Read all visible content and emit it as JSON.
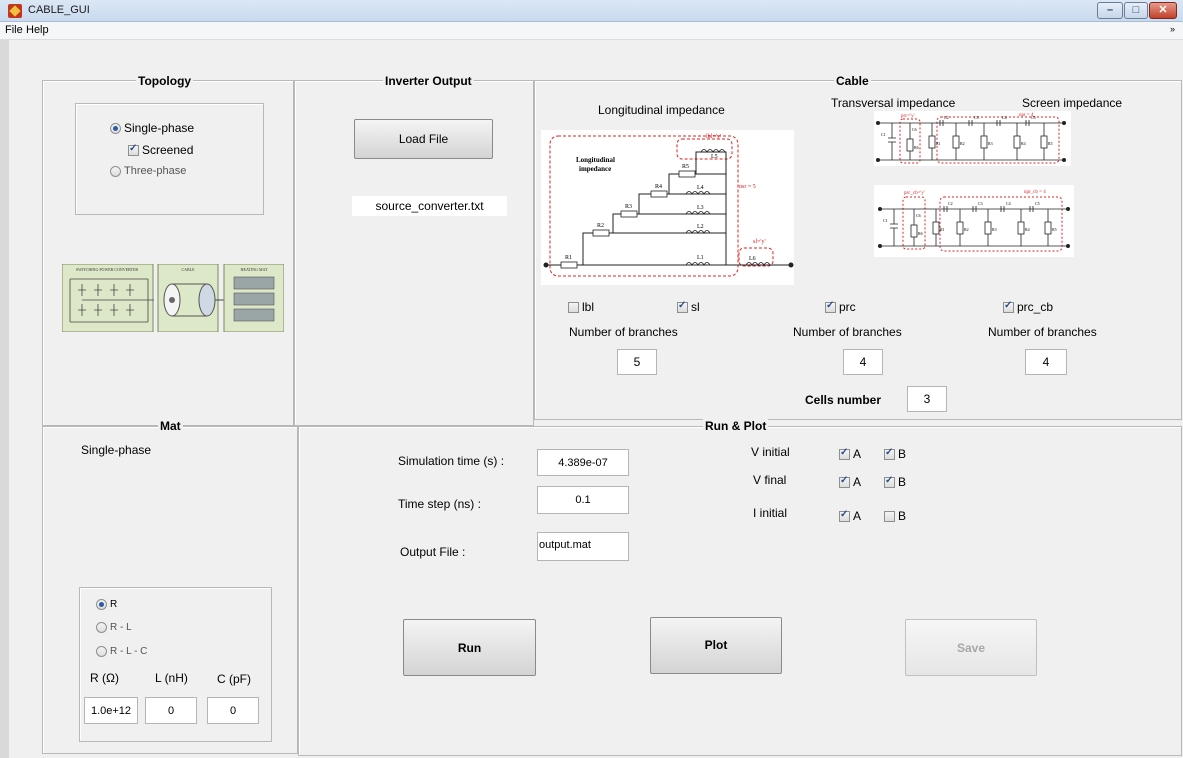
{
  "window": {
    "title": "CABLE_GUI",
    "controls": [
      "–",
      "□",
      "✕"
    ]
  },
  "menu": {
    "items": [
      "File",
      "Help"
    ],
    "arrow": "»"
  },
  "topology": {
    "title": "Topology",
    "options": {
      "single_phase": "Single-phase",
      "screened": "Screened",
      "three_phase": "Three-phase"
    },
    "image_labels": {
      "converter": "SWITCHING POWER CONVERTER",
      "cable": "CABLE",
      "mat": "HEATING MAT"
    }
  },
  "inverter": {
    "title": "Inverter Output",
    "load_button": "Load File",
    "file_name": "source_converter.txt"
  },
  "cable": {
    "title": "Cable",
    "longitudinal_title": "Longitudinal impedance",
    "transversal_title": "Transversal impedance",
    "screen_title": "Screen impedance",
    "diag_long": {
      "label1": "Longitudinal",
      "label2": "impedance",
      "lbl": "lbl='y'",
      "nsr": "nsr = 5",
      "sl": "sl='y'",
      "r": [
        "R1",
        "R2",
        "R3",
        "R4",
        "R5"
      ],
      "l": [
        "L1",
        "L2",
        "L3",
        "L4",
        "L5",
        "L6"
      ]
    },
    "diag_trans": {
      "prc": "prc='y'",
      "npr": "npr = 4",
      "labels": [
        "C1",
        "C6",
        "R6",
        "R1",
        "C2",
        "R2",
        "C3",
        "R3",
        "C4",
        "R4",
        "C5",
        "R5"
      ]
    },
    "diag_screen": {
      "prc": "prc_cb='y'",
      "npr": "npr_cb = 4",
      "labels": [
        "C1",
        "C6",
        "R6",
        "R1",
        "C2",
        "R2",
        "C3",
        "R3",
        "C4",
        "R4",
        "C5",
        "R5"
      ]
    },
    "checks": {
      "lbl": "lbl",
      "sl": "sl",
      "prc": "prc",
      "prc_cb": "prc_cb"
    },
    "branches_label": "Number of branches",
    "branches": [
      "5",
      "4",
      "4"
    ],
    "cells_label": "Cells number",
    "cells_value": "3"
  },
  "mat": {
    "title": "Mat",
    "phase_text": "Single-phase",
    "options": {
      "r": "R",
      "rl": "R - L",
      "rlc": "R - L - C"
    },
    "r_label": "R (Ω)",
    "l_label": "L (nH)",
    "c_label": "C (pF)",
    "r_value": "1.0e+12",
    "l_value": "0",
    "c_value": "0"
  },
  "run_plot": {
    "title": "Run & Plot",
    "sim_time_label": "Simulation time (s) :",
    "sim_time_value": "4.389e-07",
    "time_step_label": "Time step (ns) :",
    "time_step_value": "0.1",
    "output_label": "Output File :",
    "output_value": "output.mat",
    "v_initial": "V initial",
    "v_final": "V final",
    "i_initial": "I initial",
    "a": "A",
    "b": "B",
    "run": "Run",
    "plot": "Plot",
    "save": "Save"
  }
}
